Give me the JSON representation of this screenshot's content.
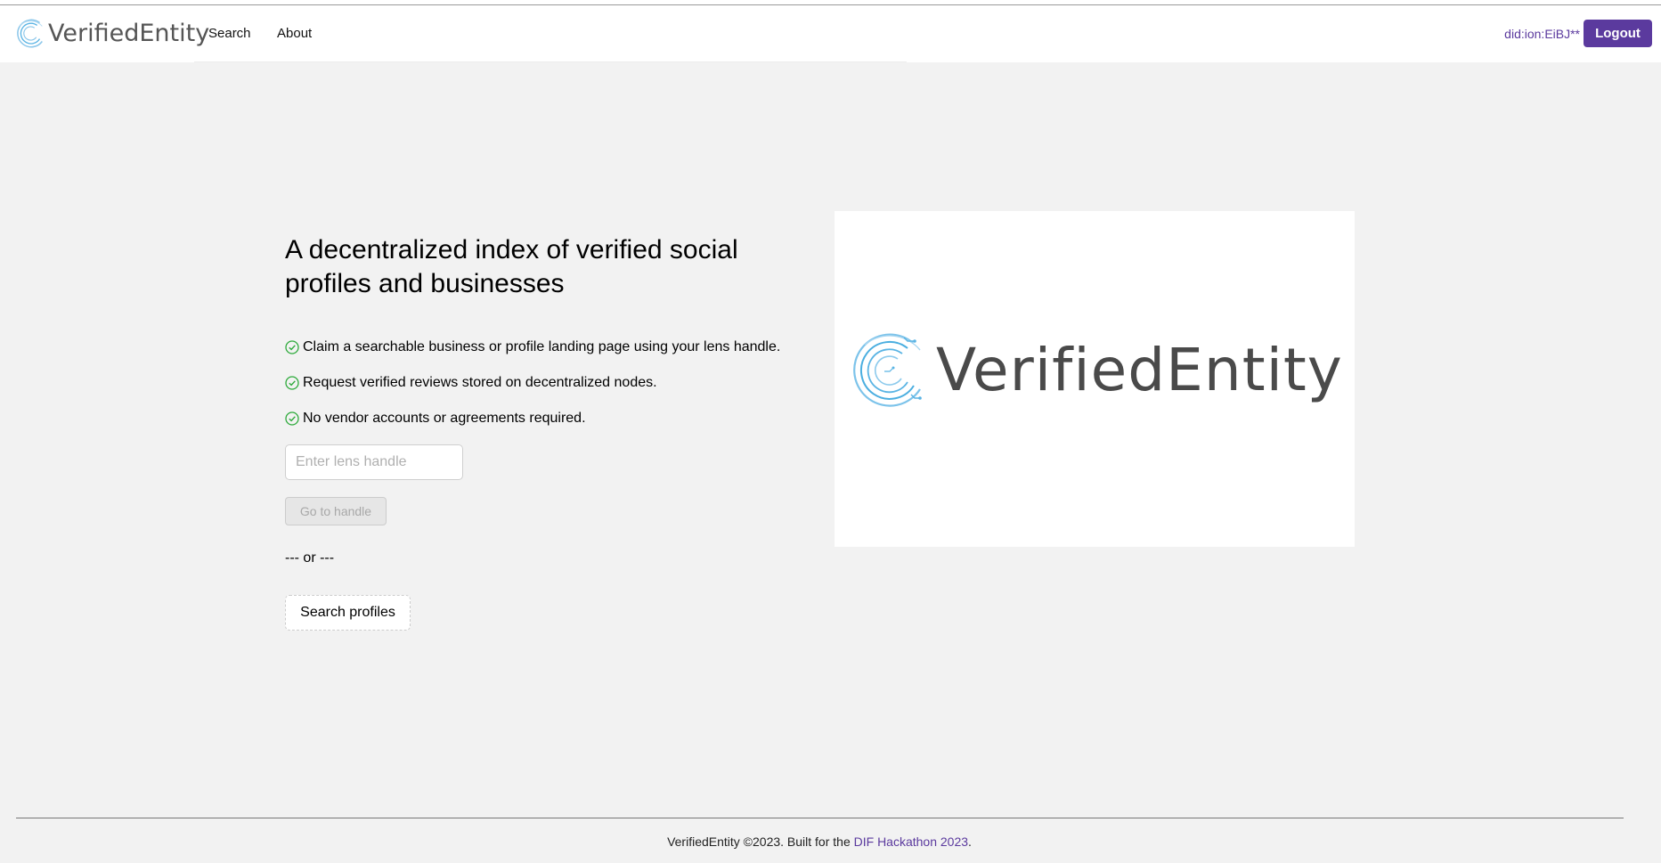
{
  "header": {
    "brand_name": "VerifiedEntity",
    "nav": [
      {
        "label": "Search"
      },
      {
        "label": "About"
      }
    ],
    "did": "did:ion:EiBJ**",
    "logout_label": "Logout"
  },
  "hero": {
    "title": "A decentralized index of verified social profiles and businesses",
    "features": [
      "Claim a searchable business or profile landing page using your lens handle.",
      "Request verified reviews stored on decentralized nodes.",
      "No vendor accounts or agreements required."
    ],
    "handle_input": {
      "placeholder": "Enter lens handle",
      "value": ""
    },
    "go_button_label": "Go to handle",
    "or_divider": "--- or ---",
    "search_button_label": "Search profiles",
    "image_text": "VerifiedEntity"
  },
  "footer": {
    "text_before": "VerifiedEntity ©2023. Built for the ",
    "link_label": "DIF Hackathon 2023",
    "text_after": "."
  },
  "colors": {
    "accent": "#5b3a9e",
    "check_green": "#2eaa3c",
    "logo_blue": "#5ab4e4",
    "background": "#f2f2f2"
  }
}
